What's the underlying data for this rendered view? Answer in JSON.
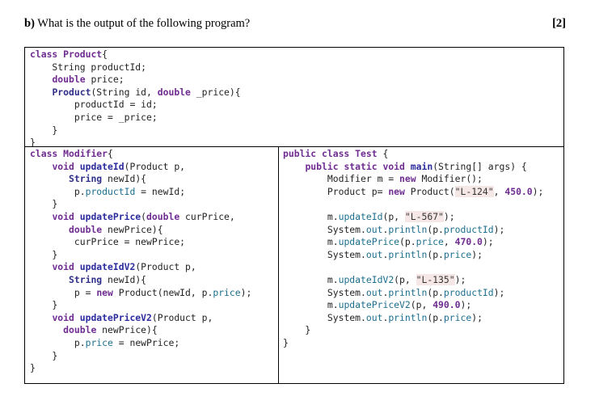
{
  "question": {
    "text": "b) What is the output of the following program?",
    "marks": "[2]"
  },
  "product_box": {
    "l1_kw": "class",
    "l1_name": "Product",
    "l1_brace": "{",
    "l2": "    String productId;",
    "l3_kw": "double",
    "l3_rest": " price;",
    "l4_name": "Product",
    "l4_a": "(String id, ",
    "l4_kw": "double",
    "l4_b": " _price){",
    "l5": "        productId = id;",
    "l6": "        price = _price;",
    "l7": "    }",
    "l8": "}"
  },
  "modifier_box": {
    "l1_kw": "class",
    "l1_name": "Modifier",
    "l1_brace": "{",
    "m1_kw": "void",
    "m1_name": "updateId",
    "m1_rest": "(Product p,",
    "m1_l2_kw": "String",
    "m1_l2_rest": " newId){",
    "m1_l3_a": "p.",
    "m1_l3_mb": "productId",
    "m1_l3_b": " = newId;",
    "m1_close": "    }",
    "m2_kw": "void",
    "m2_name": "updatePrice",
    "m2_a": "(",
    "m2_kw2": "double",
    "m2_b": " curPrice,",
    "m2_l2_kw": "double",
    "m2_l2_rest": " newPrice){",
    "m2_l3": "curPrice = newPrice;",
    "m2_close": "    }",
    "m3_kw": "void",
    "m3_name": "updateIdV2",
    "m3_rest": "(Product p,",
    "m3_l2_kw": "String",
    "m3_l2_rest": " newId){",
    "m3_l3_a": "p = ",
    "m3_l3_kw": "new",
    "m3_l3_b": " Product(newId, p.",
    "m3_l3_mb": "price",
    "m3_l3_c": ");",
    "m3_close": "    }",
    "m4_kw": "void",
    "m4_name": "updatePriceV2",
    "m4_rest": "(Product p,",
    "m4_l2_kw": "double",
    "m4_l2_rest": " newPrice){",
    "m4_l3_a": "p.",
    "m4_l3_mb": "price",
    "m4_l3_b": " = newPrice;",
    "m4_close": "    }",
    "close": "}"
  },
  "test_box": {
    "l1_kw": "public class",
    "l1_name": "Test",
    "l1_brace": " {",
    "l2_kw": "public static void",
    "l2_name": "main",
    "l2_rest": "(String[] args) {",
    "l3_a": "Modifier m = ",
    "l3_kw": "new",
    "l3_b": " Modifier();",
    "l4_a": "Product p= ",
    "l4_kw": "new",
    "l4_b": " Product(",
    "l4_str": "\"L-124\"",
    "l4_c": ", ",
    "l4_num": "450.0",
    "l4_d": ");",
    "l5_a": "m.",
    "l5_mb": "updateId",
    "l5_b": "(p, ",
    "l5_str": "\"L-567\"",
    "l5_c": ");",
    "l6_a": "System.",
    "l6_mb": "out",
    "l6_b": ".",
    "l6_mb2": "println",
    "l6_c": "(p.",
    "l6_mb3": "productId",
    "l6_d": ");",
    "l7_a": "m.",
    "l7_mb": "updatePrice",
    "l7_b": "(p.",
    "l7_mb2": "price",
    "l7_c": ", ",
    "l7_num": "470.0",
    "l7_d": ");",
    "l8_a": "System.",
    "l8_mb": "out",
    "l8_b": ".",
    "l8_mb2": "println",
    "l8_c": "(p.",
    "l8_mb3": "price",
    "l8_d": ");",
    "l9_a": "m.",
    "l9_mb": "updateIdV2",
    "l9_b": "(p, ",
    "l9_str": "\"L-135\"",
    "l9_c": ");",
    "l10_a": "System.",
    "l10_mb": "out",
    "l10_b": ".",
    "l10_mb2": "println",
    "l10_c": "(p.",
    "l10_mb3": "productId",
    "l10_d": ");",
    "l11_a": "m.",
    "l11_mb": "updatePriceV2",
    "l11_b": "(p, ",
    "l11_num": "490.0",
    "l11_c": ");",
    "l12_a": "System.",
    "l12_mb": "out",
    "l12_b": ".",
    "l12_mb2": "println",
    "l12_c": "(p.",
    "l12_mb3": "price",
    "l12_d": ");",
    "l13": "    }",
    "l14": "}"
  }
}
